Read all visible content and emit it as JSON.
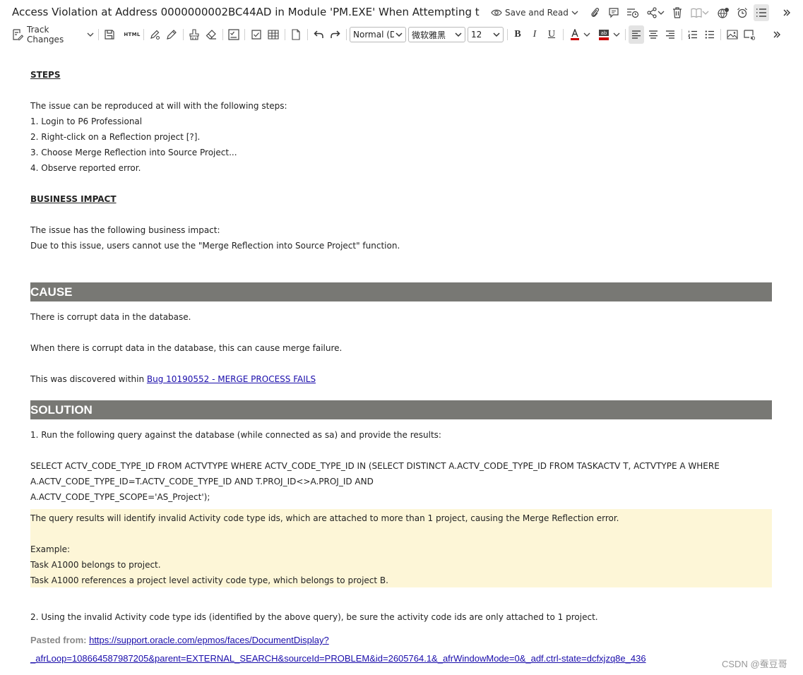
{
  "header": {
    "title": "Access Violation at Address 0000000002BC44AD in Module 'PM.EXE' When Attempting to \"Merge Reflection into Source Project\"",
    "save_and_read_label": "Save and Read"
  },
  "toolbar": {
    "track_changes_label": "Track Changes",
    "html_label": "HTML",
    "style_value": "Normal (DIV)",
    "font_value": "微软雅黑",
    "size_value": "12",
    "bold_label": "B",
    "italic_label": "I",
    "underline_label": "U",
    "font_color": "#cc0000",
    "highlight_color": "#cc0000"
  },
  "document": {
    "steps_heading": "STEPS",
    "steps_intro": "The issue can be reproduced at will with the following steps:",
    "steps": [
      "1. Login to P6 Professional",
      "2. Right-click on a Reflection project [?].",
      "3. Choose Merge Reflection into Source Project...",
      "4. Observe reported error."
    ],
    "impact_heading": "BUSINESS IMPACT",
    "impact_intro": "The issue has the following business impact:",
    "impact_text": "Due to this issue, users cannot use the \"Merge Reflection into Source Project\" function.",
    "cause_heading": "CAUSE",
    "cause_1": "There is corrupt data in the database.",
    "cause_2": "When there is corrupt data in the database, this can cause merge failure.",
    "cause_3_prefix": "This was discovered within ",
    "cause_3_link": "Bug 10190552 - MERGE PROCESS FAILS",
    "solution_heading": "SOLUTION",
    "solution_step1": "1. Run the following query against the database (while connected as sa) and provide the results:",
    "query_lines": [
      "SELECT ACTV_CODE_TYPE_ID FROM ACTVTYPE WHERE ACTV_CODE_TYPE_ID IN (SELECT DISTINCT A.ACTV_CODE_TYPE_ID FROM TASKACTV T, ACTVTYPE A WHERE",
      "A.ACTV_CODE_TYPE_ID=T.ACTV_CODE_TYPE_ID AND T.PROJ_ID<>A.PROJ_ID AND",
      "A.ACTV_CODE_TYPE_SCOPE='AS_Project');"
    ],
    "note_lines": [
      "The query results will identify invalid Activity code type ids, which are attached to more than 1 project, causing the Merge Reflection error.",
      "Example:",
      "Task A1000 belongs to project.",
      "Task A1000 references a project level activity code type, which belongs to project B."
    ],
    "solution_step2": "2. Using the invalid Activity code type ids (identified by the above query), be sure the activity code ids are only attached to 1 project.",
    "pasted_from_label": "Pasted from:",
    "pasted_link_line1": "https://support.oracle.com/epmos/faces/DocumentDisplay?",
    "pasted_link_line2": "_afrLoop=108664587987205&parent=EXTERNAL_SEARCH&sourceId=PROBLEM&id=2605764.1&_afrWindowMode=0&_adf.ctrl-state=dcfxjzq8e_436"
  },
  "watermark": "CSDN @蚕豆哥",
  "colors": {
    "section_bar": "#787874",
    "note_background": "#fdf6d7",
    "link": "#1a0dab"
  }
}
